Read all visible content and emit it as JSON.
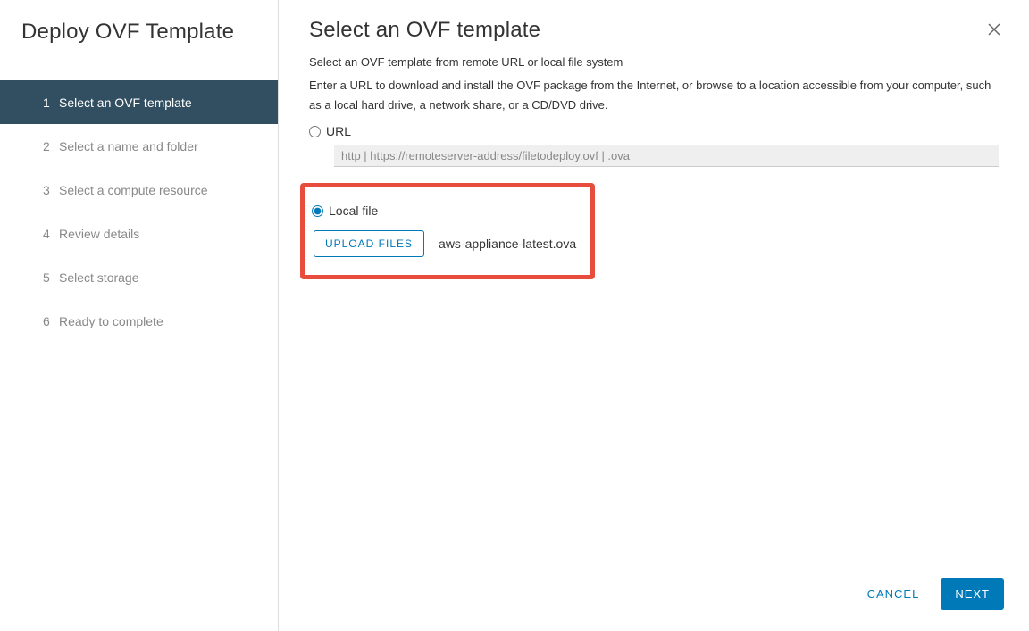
{
  "sidebar": {
    "title": "Deploy OVF Template",
    "steps": [
      {
        "num": "1",
        "label": "Select an OVF template"
      },
      {
        "num": "2",
        "label": "Select a name and folder"
      },
      {
        "num": "3",
        "label": "Select a compute resource"
      },
      {
        "num": "4",
        "label": "Review details"
      },
      {
        "num": "5",
        "label": "Select storage"
      },
      {
        "num": "6",
        "label": "Ready to complete"
      }
    ]
  },
  "main": {
    "title": "Select an OVF template",
    "instruction_1": "Select an OVF template from remote URL or local file system",
    "instruction_2": "Enter a URL to download and install the OVF package from the Internet, or browse to a location accessible from your computer, such as a local hard drive, a network share, or a CD/DVD drive.",
    "url_label": "URL",
    "url_placeholder": "http | https://remoteserver-address/filetodeploy.ovf | .ova",
    "localfile_label": "Local file",
    "upload_btn": "UPLOAD FILES",
    "filename": "aws-appliance-latest.ova"
  },
  "footer": {
    "cancel": "CANCEL",
    "next": "NEXT"
  }
}
